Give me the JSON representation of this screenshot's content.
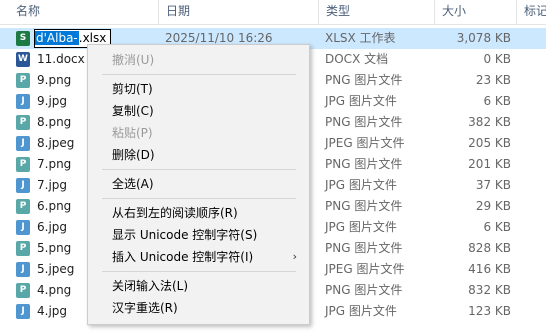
{
  "columns": {
    "name": "名称",
    "date": "日期",
    "type": "类型",
    "size": "大小",
    "tags": "标记"
  },
  "rows": [
    {
      "name": "d'Alba-.xlsx",
      "date": "2025/11/10 16:26",
      "type": "XLSX 工作表",
      "size": "3,078 KB",
      "icon": "xlsx"
    },
    {
      "name": "11.docx",
      "date": "",
      "type": "DOCX 文档",
      "size": "0 KB",
      "icon": "docx"
    },
    {
      "name": "9.png",
      "date": "",
      "type": "PNG 图片文件",
      "size": "23 KB",
      "icon": "png"
    },
    {
      "name": "9.jpg",
      "date": "",
      "type": "JPG 图片文件",
      "size": "6 KB",
      "icon": "jpg"
    },
    {
      "name": "8.png",
      "date": "",
      "type": "PNG 图片文件",
      "size": "382 KB",
      "icon": "png"
    },
    {
      "name": "8.jpeg",
      "date": "",
      "type": "JPEG 图片文件",
      "size": "205 KB",
      "icon": "jpeg"
    },
    {
      "name": "7.png",
      "date": "",
      "type": "PNG 图片文件",
      "size": "201 KB",
      "icon": "png"
    },
    {
      "name": "7.jpg",
      "date": "",
      "type": "JPG 图片文件",
      "size": "37 KB",
      "icon": "jpg"
    },
    {
      "name": "6.png",
      "date": "",
      "type": "PNG 图片文件",
      "size": "29 KB",
      "icon": "png"
    },
    {
      "name": "6.jpg",
      "date": "",
      "type": "JPG 图片文件",
      "size": "6 KB",
      "icon": "jpg"
    },
    {
      "name": "5.png",
      "date": "",
      "type": "PNG 图片文件",
      "size": "828 KB",
      "icon": "png"
    },
    {
      "name": "5.jpeg",
      "date": "",
      "type": "JPEG 图片文件",
      "size": "416 KB",
      "icon": "jpeg"
    },
    {
      "name": "4.png",
      "date": "",
      "type": "PNG 图片文件",
      "size": "832 KB",
      "icon": "png"
    },
    {
      "name": "4.jpg",
      "date": "",
      "type": "JPG 图片文件",
      "size": "123 KB",
      "icon": "jpg"
    }
  ],
  "rename": {
    "selected_text": "d'Alba-",
    "rest_text": ".xlsx"
  },
  "context_menu": {
    "undo": "撤消(U)",
    "cut": "剪切(T)",
    "copy": "复制(C)",
    "paste": "粘贴(P)",
    "delete": "删除(D)",
    "select_all": "全选(A)",
    "rtl_reading": "从右到左的阅读顺序(R)",
    "show_unicode": "显示 Unicode 控制字符(S)",
    "insert_unicode": "插入 Unicode 控制字符(I)",
    "close_ime": "关闭输入法(L)",
    "reconversion": "汉字重选(R)"
  },
  "icons": {
    "xlsx": "S",
    "docx": "W",
    "png": "P",
    "jpg": "J",
    "jpeg": "J",
    "submenu_arrow": "›"
  },
  "colors": {
    "selection": "#cce8ff",
    "rename_highlight": "#0078d7",
    "menu_bg": "#f2f2f2"
  }
}
